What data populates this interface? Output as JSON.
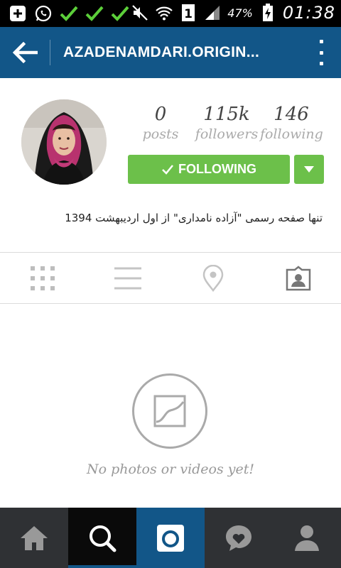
{
  "status_bar": {
    "icons_left": [
      "add-notification-icon",
      "whatsapp-icon",
      "check-icon",
      "check-icon",
      "check-icon"
    ],
    "icons_right": [
      "mute-icon",
      "wifi-icon",
      "sim-1-icon",
      "signal-icon",
      "battery-icon"
    ],
    "battery": "47%",
    "time": "01:38"
  },
  "app_bar": {
    "title": "AZADENAMDARI.ORIGIN...",
    "color": "#125688"
  },
  "profile": {
    "stats": [
      {
        "value": "0",
        "label": "posts"
      },
      {
        "value": "115k",
        "label": "followers"
      },
      {
        "value": "146",
        "label": "following"
      }
    ],
    "follow_button": "FOLLOWING",
    "follow_color": "#6cc04a",
    "bio": "تنها صفحه رسمی \"آزاده نامداری\" از اول اردیبهشت 1394"
  },
  "tabs": [
    "grid-icon",
    "list-icon",
    "location-icon",
    "tagged-icon"
  ],
  "empty_state": {
    "message": "No photos or videos yet!"
  },
  "bottom_nav": [
    "home-icon",
    "search-icon",
    "camera-icon",
    "activity-icon",
    "profile-icon"
  ]
}
